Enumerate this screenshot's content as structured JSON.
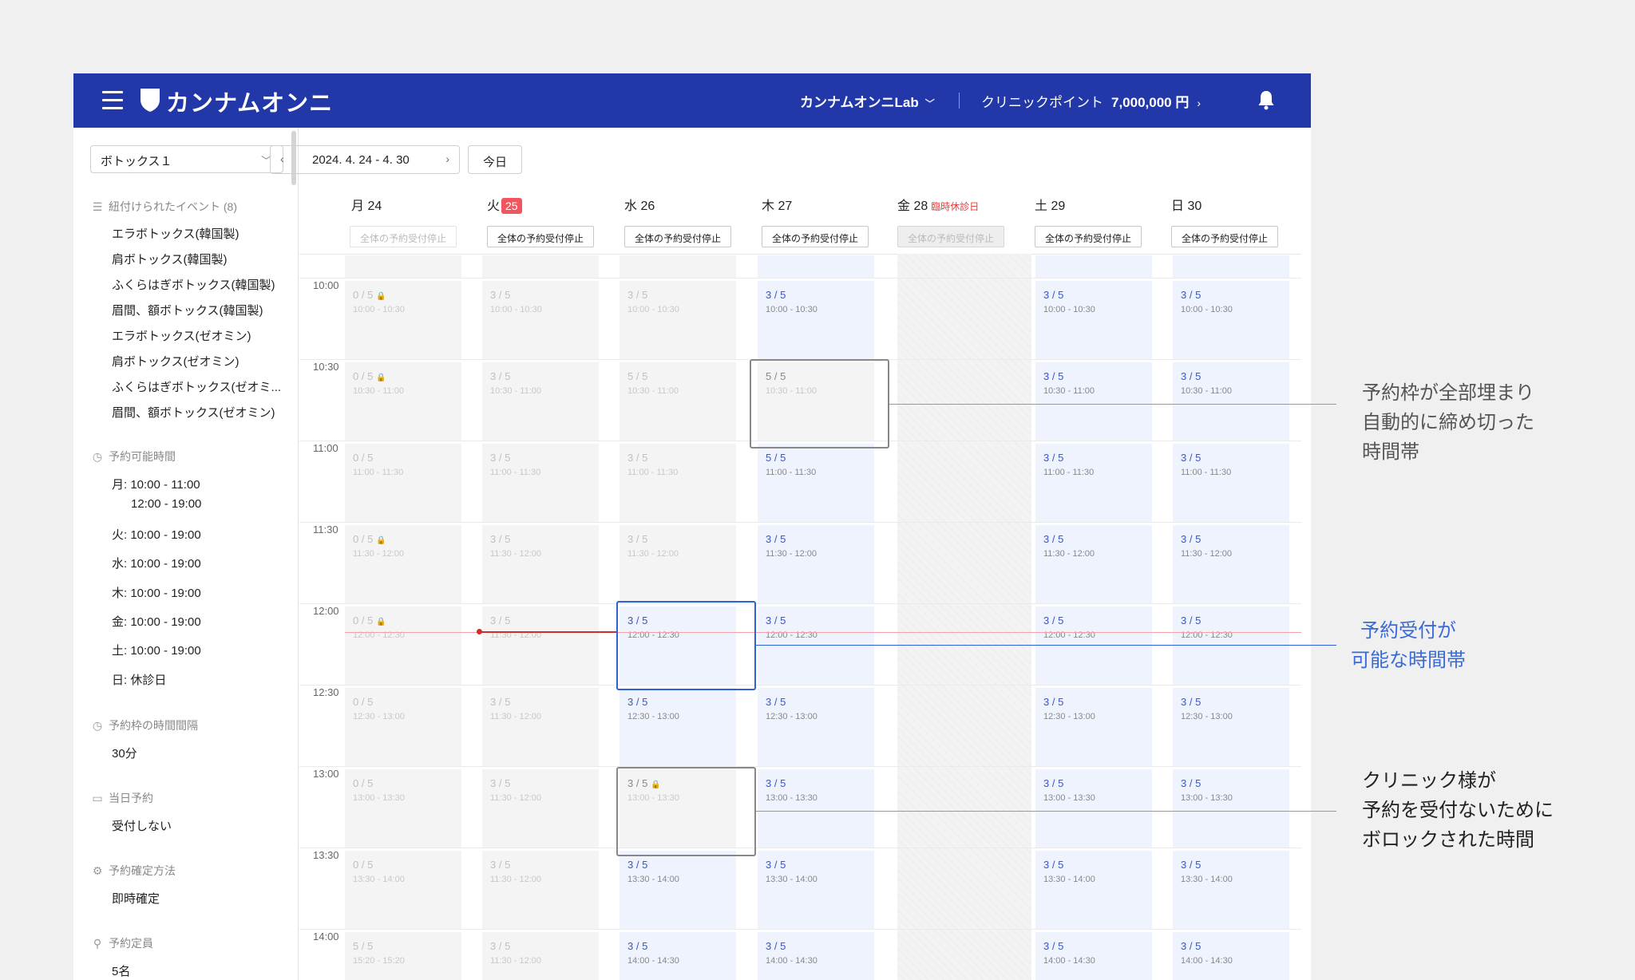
{
  "header": {
    "brand": "カンナムオンニ",
    "account": "カンナムオンニLab",
    "points_label": "クリニックポイント",
    "points_value": "7,000,000 円"
  },
  "sidebar": {
    "selected_item": "ボトックス１",
    "linked_events_title": "紐付けられたイベント (8)",
    "linked_events": [
      "エラボトックス(韓国製)",
      "肩ボトックス(韓国製)",
      "ふくらはぎボトックス(韓国製)",
      "眉間、額ボトックス(韓国製)",
      "エラボトックス(ゼオミン)",
      "肩ボトックス(ゼオミン)",
      "ふくらはぎボトックス(ゼオミ...",
      "眉間、額ボトックス(ゼオミン)"
    ],
    "available_time_title": "予約可能時間",
    "available_time": [
      "月: 10:00 - 11:00",
      "12:00 - 19:00",
      "火: 10:00 - 19:00",
      "水: 10:00 - 19:00",
      "木: 10:00 - 19:00",
      "金: 10:00 - 19:00",
      "土: 10:00 - 19:00",
      "日: 休診日"
    ],
    "interval_title": "予約枠の時間間隔",
    "interval_value": "30分",
    "same_day_title": "当日予約",
    "same_day_value": "受付しない",
    "confirm_title": "予約確定方法",
    "confirm_value": "即時確定",
    "capacity_title": "予約定員",
    "capacity_value": "5名"
  },
  "toolbar": {
    "date_range": "2024. 4. 24 - 4. 30",
    "today_label": "今日"
  },
  "days": [
    {
      "label": "月 24"
    },
    {
      "label": "火",
      "badge": "25"
    },
    {
      "label": "水 26"
    },
    {
      "label": "木 27"
    },
    {
      "label": "金 28",
      "holiday": "臨時休診日"
    },
    {
      "label": "土 29"
    },
    {
      "label": "日 30"
    }
  ],
  "stop_label": "全体の予約受付停止",
  "times": [
    "10:00",
    "10:30",
    "11:00",
    "11:30",
    "12:00",
    "12:30",
    "13:00",
    "13:30",
    "14:00"
  ],
  "slots": {
    "mon": [
      {
        "c": "0 / 5",
        "r": "10:00 - 10:30",
        "lock": true
      },
      {
        "c": "0 / 5",
        "r": "10:30 - 11:00",
        "lock": true
      },
      {
        "c": "0 / 5",
        "r": "11:00 - 11:30"
      },
      {
        "c": "0 / 5",
        "r": "11:30 - 12:00",
        "lock": true
      },
      {
        "c": "0 / 5",
        "r": "12:00 - 12:30",
        "lock": true
      },
      {
        "c": "0 / 5",
        "r": "12:30 - 13:00"
      },
      {
        "c": "0 / 5",
        "r": "13:00 - 13:30"
      },
      {
        "c": "0 / 5",
        "r": "13:30 - 14:00"
      },
      {
        "c": "5 / 5",
        "r": "15:20 - 15:20"
      }
    ],
    "tue": [
      {
        "c": "3 / 5",
        "r": "10:00 - 10:30"
      },
      {
        "c": "3 / 5",
        "r": "10:30 - 11:00"
      },
      {
        "c": "3 / 5",
        "r": "11:00 - 11:30"
      },
      {
        "c": "3 / 5",
        "r": "11:30 - 12:00"
      },
      {
        "c": "3 / 5",
        "r": "11:30 - 12:00"
      },
      {
        "c": "3 / 5",
        "r": "11:30 - 12:00"
      },
      {
        "c": "3 / 5",
        "r": "11:30 - 12:00"
      },
      {
        "c": "3 / 5",
        "r": "11:30 - 12:00"
      },
      {
        "c": "3 / 5",
        "r": "11:30 - 12:00"
      }
    ],
    "wed": [
      {
        "c": "3 / 5",
        "r": "10:00 - 10:30"
      },
      {
        "c": "5 / 5",
        "r": "10:30 - 11:00"
      },
      {
        "c": "3 / 5",
        "r": "11:00 - 11:30"
      },
      {
        "c": "3 / 5",
        "r": "11:30 - 12:00"
      },
      {
        "c": "3 / 5",
        "r": "12:00 - 12:30"
      },
      {
        "c": "3 / 5",
        "r": "12:30 - 13:00"
      },
      {
        "c": "3 / 5",
        "r": "13:00 - 13:30",
        "lock": true
      },
      {
        "c": "3 / 5",
        "r": "13:30 - 14:00"
      },
      {
        "c": "3 / 5",
        "r": "14:00 - 14:30"
      }
    ],
    "thu": [
      {
        "c": "3 / 5",
        "r": "10:00 - 10:30"
      },
      {
        "c": "5 / 5",
        "r": "10:30 - 11:00"
      },
      {
        "c": "5 / 5",
        "r": "11:00 - 11:30"
      },
      {
        "c": "3 / 5",
        "r": "11:30 - 12:00"
      },
      {
        "c": "3 / 5",
        "r": "12:00 - 12:30"
      },
      {
        "c": "3 / 5",
        "r": "12:30 - 13:00"
      },
      {
        "c": "3 / 5",
        "r": "13:00 - 13:30"
      },
      {
        "c": "3 / 5",
        "r": "13:30 - 14:00"
      },
      {
        "c": "3 / 5",
        "r": "14:00 - 14:30"
      }
    ],
    "sat": [
      {
        "c": "3 / 5",
        "r": "10:00 - 10:30"
      },
      {
        "c": "3 / 5",
        "r": "10:30 - 11:00"
      },
      {
        "c": "3 / 5",
        "r": "11:00 - 11:30"
      },
      {
        "c": "3 / 5",
        "r": "11:30 - 12:00"
      },
      {
        "c": "3 / 5",
        "r": "12:00 - 12:30"
      },
      {
        "c": "3 / 5",
        "r": "12:30 - 13:00"
      },
      {
        "c": "3 / 5",
        "r": "13:00 - 13:30"
      },
      {
        "c": "3 / 5",
        "r": "13:30 - 14:00"
      },
      {
        "c": "3 / 5",
        "r": "14:00 - 14:30"
      }
    ],
    "sun": [
      {
        "c": "3 / 5",
        "r": "10:00 - 10:30"
      },
      {
        "c": "3 / 5",
        "r": "10:30 - 11:00"
      },
      {
        "c": "3 / 5",
        "r": "11:00 - 11:30"
      },
      {
        "c": "3 / 5",
        "r": "11:30 - 12:00"
      },
      {
        "c": "3 / 5",
        "r": "12:00 - 12:30"
      },
      {
        "c": "3 / 5",
        "r": "12:30 - 13:00"
      },
      {
        "c": "3 / 5",
        "r": "13:00 - 13:30"
      },
      {
        "c": "3 / 5",
        "r": "13:30 - 14:00"
      },
      {
        "c": "3 / 5",
        "r": "14:00 - 14:30"
      }
    ]
  },
  "annotations": {
    "full": [
      "予約枠が全部埋まり",
      "自動的に締め切った",
      "時間帯"
    ],
    "open": [
      "予約受付が",
      "可能な時間帯"
    ],
    "blocked": [
      "クリニック様が",
      "予約を受付ないために",
      "ボロックされた時間"
    ]
  },
  "colors": {
    "header_bg": "#2338a8",
    "accent_blue": "#3060d8",
    "now_line": "#d12b2b",
    "today_badge": "#f1565f"
  }
}
